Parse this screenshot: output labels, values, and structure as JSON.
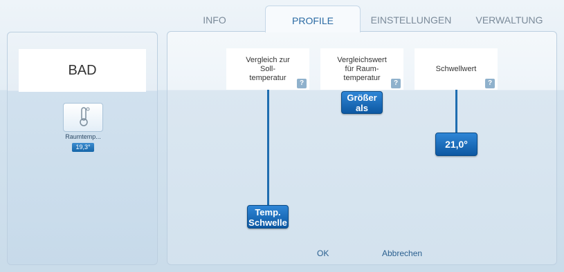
{
  "tabs": [
    "INFO",
    "PROFILE",
    "EINSTELLUNGEN",
    "VERWALTUNG"
  ],
  "room": {
    "name": "BAD",
    "device": {
      "label": "Raumtemp...",
      "value": "19,3°"
    }
  },
  "columns": [
    {
      "label": "Vergleich zur Soll-temperatur",
      "lines": [
        "Vergleich zur",
        "Soll-",
        "temperatur"
      ],
      "help": "?"
    },
    {
      "label": "Vergleichswert für Raum-temperatur",
      "lines": [
        "Vergleichswert",
        "für Raum-",
        "temperatur"
      ],
      "help": "?"
    },
    {
      "label": "Schwellwert",
      "lines": [
        "Schwellwert"
      ],
      "help": "?"
    }
  ],
  "nodes": {
    "temp_schwelle": [
      "Temp.",
      "Schwelle"
    ],
    "groesser_als": [
      "Größer",
      "als"
    ],
    "threshold": "21,0°"
  },
  "footer": {
    "ok": "OK",
    "cancel": "Abbrechen"
  }
}
